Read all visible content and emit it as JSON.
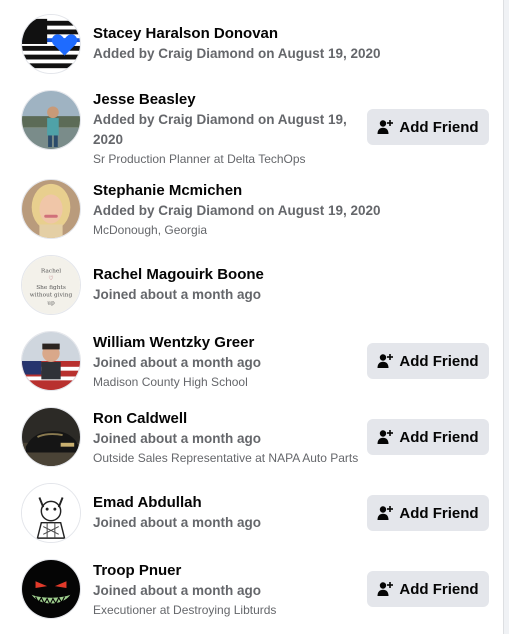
{
  "colors": {
    "background": "#f0f2f5",
    "panel": "#ffffff",
    "button_bg": "#e4e6eb",
    "primary_text": "#050505",
    "secondary_text": "#65676b"
  },
  "members": [
    {
      "name": "Stacey Haralson Donovan",
      "status": "Added by Craig Diamond on August 19, 2020",
      "detail": "",
      "avatar": "thin-blue-line-flag-heart",
      "button": ""
    },
    {
      "name": "Jesse Beasley",
      "status": "Added by Craig Diamond on August 19, 2020",
      "detail": "Sr Production Planner at Delta TechOps",
      "avatar": "person-by-lake-photo",
      "button": "Add Friend"
    },
    {
      "name": "Stephanie Mcmichen",
      "status": "Added by Craig Diamond on August 19, 2020",
      "detail": "McDonough, Georgia",
      "avatar": "blonde-woman-photo",
      "button": ""
    },
    {
      "name": "Rachel Magouirk Boone",
      "status": "Joined about a month ago",
      "detail": "",
      "avatar": "handwritten-note-photo",
      "avatar_text": [
        "Rachel",
        "She fights",
        "without giving",
        "up"
      ],
      "button": ""
    },
    {
      "name": "William Wentzky Greer",
      "status": "Joined about a month ago",
      "detail": "Madison County High School",
      "avatar": "man-with-flag-photo",
      "button": "Add Friend"
    },
    {
      "name": "Ron Caldwell",
      "status": "Joined about a month ago",
      "detail": "Outside Sales Representative at NAPA Auto Parts",
      "avatar": "black-car-photo",
      "button": "Add Friend"
    },
    {
      "name": "Emad Abdullah",
      "status": "Joined about a month ago",
      "detail": "",
      "avatar": "horned-sketch-drawing",
      "button": "Add Friend"
    },
    {
      "name": "Troop Pnuer",
      "status": "Joined about a month ago",
      "detail": "Executioner at Destroying Libturds",
      "avatar": "grinning-monster-face",
      "button": "Add Friend"
    }
  ]
}
